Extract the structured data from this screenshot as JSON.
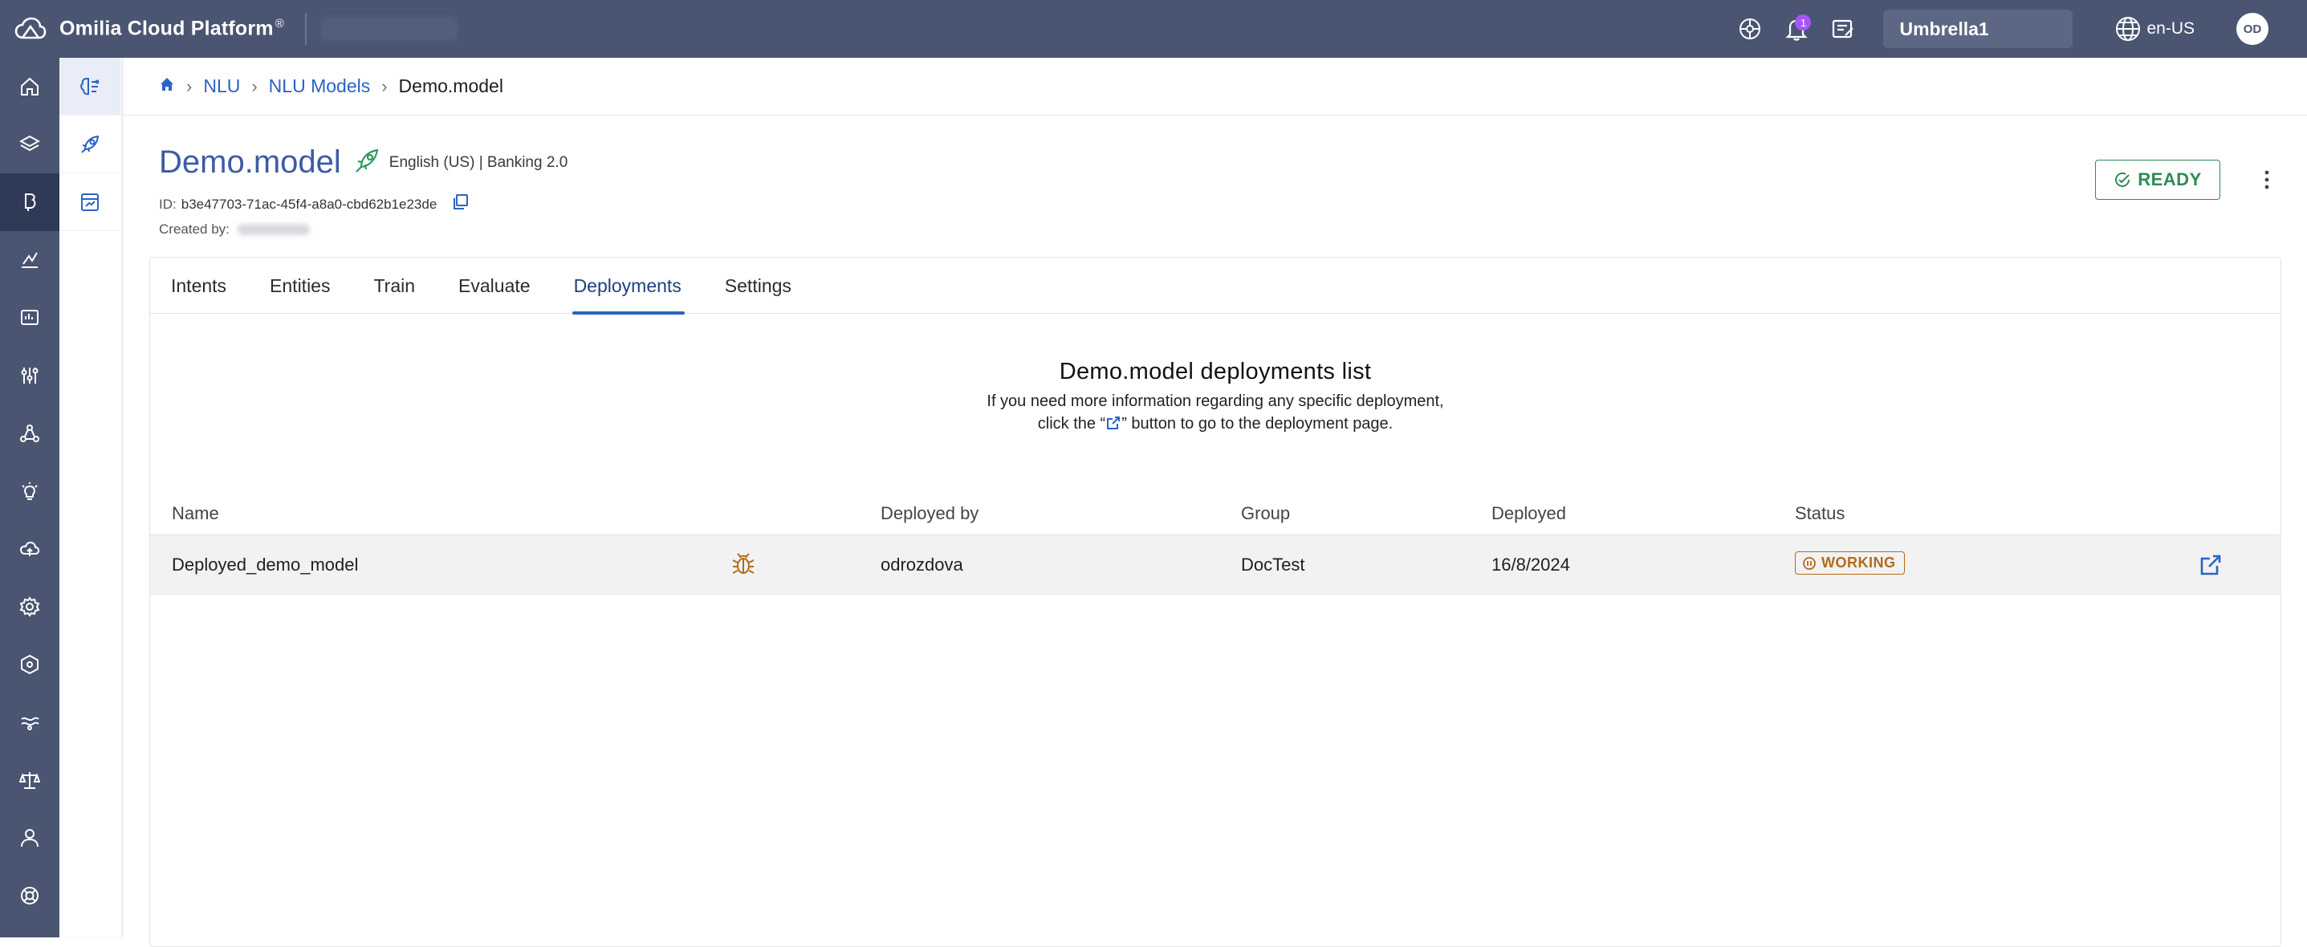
{
  "app": {
    "title": "Omilia Cloud Platform",
    "reg_mark": "®",
    "notifications_count": "1",
    "tenant": "Umbrella1",
    "language": "en-US",
    "user_initials": "OD"
  },
  "breadcrumb": {
    "items": [
      "NLU",
      "NLU Models"
    ],
    "current": "Demo.model"
  },
  "model": {
    "name": "Demo.model",
    "meta": "English (US) | Banking 2.0",
    "id_label": "ID:",
    "id_value": "b3e47703-71ac-45f4-a8a0-cbd62b1e23de",
    "created_label": "Created by:",
    "status_button": "READY"
  },
  "tabs": [
    "Intents",
    "Entities",
    "Train",
    "Evaluate",
    "Deployments",
    "Settings"
  ],
  "active_tab": "Deployments",
  "deployments": {
    "heading": "Demo.model deployments list",
    "desc_line1": "If you need more information regarding any specific deployment,",
    "desc_line2_pre": "click the “",
    "desc_line2_post": "” button to go to the deployment page.",
    "columns": [
      "Name",
      "Deployed by",
      "Group",
      "Deployed",
      "Status"
    ],
    "rows": [
      {
        "name": "Deployed_demo_model",
        "deployed_by": "odrozdova",
        "group": "DocTest",
        "deployed": "16/8/2024",
        "status": "WORKING"
      }
    ]
  },
  "colors": {
    "topbar": "#4a5572",
    "accent": "#2a63c4",
    "ready": "#2e8b57",
    "working": "#b36b18",
    "title": "#3e5aa6"
  },
  "icons": {
    "rail": [
      "home-icon",
      "layers-icon",
      "nlu-icon",
      "analytics-icon",
      "monitor-icon",
      "sliders-icon",
      "network-icon",
      "bulb-icon",
      "cloud-icon",
      "settings-gear-icon",
      "hexagon-icon",
      "flow-icon",
      "balance-icon",
      "user-icon",
      "support-icon"
    ],
    "subnav": [
      "brain-icon",
      "rocket-icon",
      "report-icon"
    ]
  }
}
